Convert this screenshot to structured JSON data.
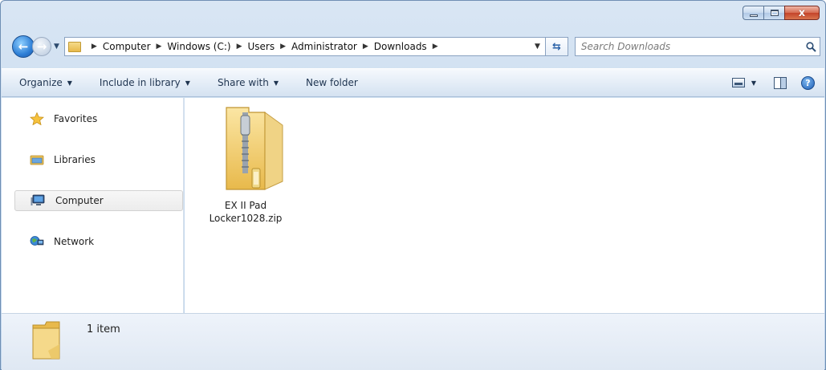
{
  "titlebar": {
    "minimize_icon": "minimize-icon",
    "maximize_icon": "maximize-icon",
    "close_glyph": "x"
  },
  "navigation": {
    "back_icon": "back-arrow-icon",
    "forward_icon": "forward-arrow-icon",
    "breadcrumbs": [
      "Computer",
      "Windows (C:)",
      "Users",
      "Administrator",
      "Downloads"
    ],
    "refresh_icon": "refresh-icon"
  },
  "search": {
    "placeholder": "Search Downloads",
    "value": ""
  },
  "toolbar": {
    "organize_label": "Organize",
    "include_label": "Include in library",
    "share_label": "Share with",
    "newfolder_label": "New folder"
  },
  "sidebar": {
    "items": [
      {
        "label": "Favorites",
        "icon": "star-icon"
      },
      {
        "label": "Libraries",
        "icon": "libraries-icon"
      },
      {
        "label": "Computer",
        "icon": "computer-icon",
        "selected": true
      },
      {
        "label": "Network",
        "icon": "network-icon"
      }
    ]
  },
  "files": [
    {
      "name_line1": "EX II Pad",
      "name_line2": "Locker1028.zip",
      "icon": "zip-folder-icon"
    }
  ],
  "details": {
    "item_count": "1 item"
  },
  "colors": {
    "accent": "#2f7fd6",
    "close_button": "#c4442a",
    "folder": "#e8b94b"
  }
}
